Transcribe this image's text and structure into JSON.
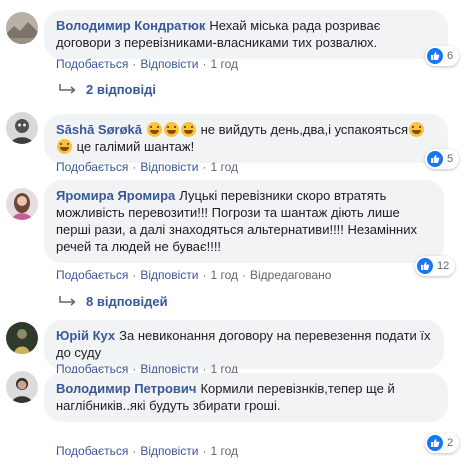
{
  "colors": {
    "author_link": "#385898",
    "bubble_bg": "#f2f3f5",
    "like_blue": "#1877f2",
    "meta_grey": "#616770"
  },
  "comments": [
    {
      "author": "Володимир Кондратюк",
      "text": "Нехай міська рада розриває договори з перевізниками-власниками тих розвалюх.",
      "like_label": "Подобається",
      "reply_label": "Відповісти",
      "time": "1 год",
      "edited": "",
      "reactions": "6",
      "replies_label": "2 відповіді",
      "avatar_icon": "avatar-landscape"
    },
    {
      "author": "Sāshā Sørøkā",
      "text_part1": "",
      "text_part2": "не вийдуть день,два,і успакояться",
      "text_part3": "це галімий шантаж!",
      "like_label": "Подобається",
      "reply_label": "Відповісти",
      "time": "1 год",
      "reactions": "5",
      "emoji_icon": "rofl-emoji-icon",
      "avatar_icon": "avatar-person-icon"
    },
    {
      "author": "Яромира Яромира",
      "text": "Луцькі перевізники скоро втратять можливість перевозити!!! Погрози та шантаж діють лише перші рази, а далі знаходяться альтернативи!!!! Незамінних речей та людей не буває!!!!",
      "like_label": "Подобається",
      "reply_label": "Відповісти",
      "time": "1 год",
      "edited": "Відредаговано",
      "reactions": "12",
      "replies_label": "8 відповідей",
      "avatar_icon": "avatar-woman-icon"
    },
    {
      "author": "Юрій Кух",
      "text": "За невиконання договору на перевезення подати їх до суду",
      "like_label": "Подобається",
      "reply_label": "Відповісти",
      "time": "1 год",
      "avatar_icon": "avatar-dark-icon"
    },
    {
      "author": "Володимир Петрович",
      "text": "Кормили перевізнків,тепер ще й наглібників..які будуть збирати гроші.",
      "like_label": "Подобається",
      "reply_label": "Відповісти",
      "time": "1 год",
      "reactions": "2",
      "avatar_icon": "avatar-man-icon"
    }
  ],
  "dot": "·"
}
